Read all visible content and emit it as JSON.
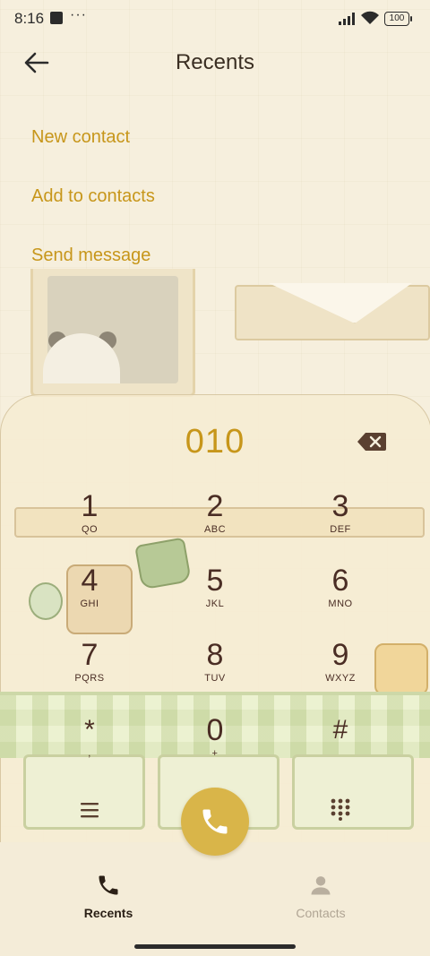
{
  "status_bar": {
    "time": "8:16",
    "dots": "···",
    "battery": "100"
  },
  "header": {
    "title": "Recents",
    "back_icon": "arrow-left-icon"
  },
  "menu": [
    {
      "label": "New contact"
    },
    {
      "label": "Add to contacts"
    },
    {
      "label": "Send message"
    }
  ],
  "dialer": {
    "number": "010",
    "keys": [
      {
        "digit": "1",
        "letters": "QO"
      },
      {
        "digit": "2",
        "letters": "ABC"
      },
      {
        "digit": "3",
        "letters": "DEF"
      },
      {
        "digit": "4",
        "letters": "GHI"
      },
      {
        "digit": "5",
        "letters": "JKL"
      },
      {
        "digit": "6",
        "letters": "MNO"
      },
      {
        "digit": "7",
        "letters": "PQRS"
      },
      {
        "digit": "8",
        "letters": "TUV"
      },
      {
        "digit": "9",
        "letters": "WXYZ"
      },
      {
        "digit": "*",
        "letters": ","
      },
      {
        "digit": "0",
        "letters": "+"
      },
      {
        "digit": "#",
        "letters": ""
      }
    ],
    "backspace_icon": "backspace-icon",
    "menu_icon": "menu-lines-icon",
    "keypad_icon": "dialpad-icon",
    "call_icon": "phone-icon"
  },
  "bottom_nav": {
    "tabs": [
      {
        "label": "Recents",
        "icon": "phone-icon",
        "active": true
      },
      {
        "label": "Contacts",
        "icon": "person-icon",
        "active": false
      }
    ]
  },
  "colors": {
    "accent": "#c7961a",
    "call_button": "#d9b549",
    "background": "#f6efdd",
    "key_text": "#4a2d24"
  }
}
